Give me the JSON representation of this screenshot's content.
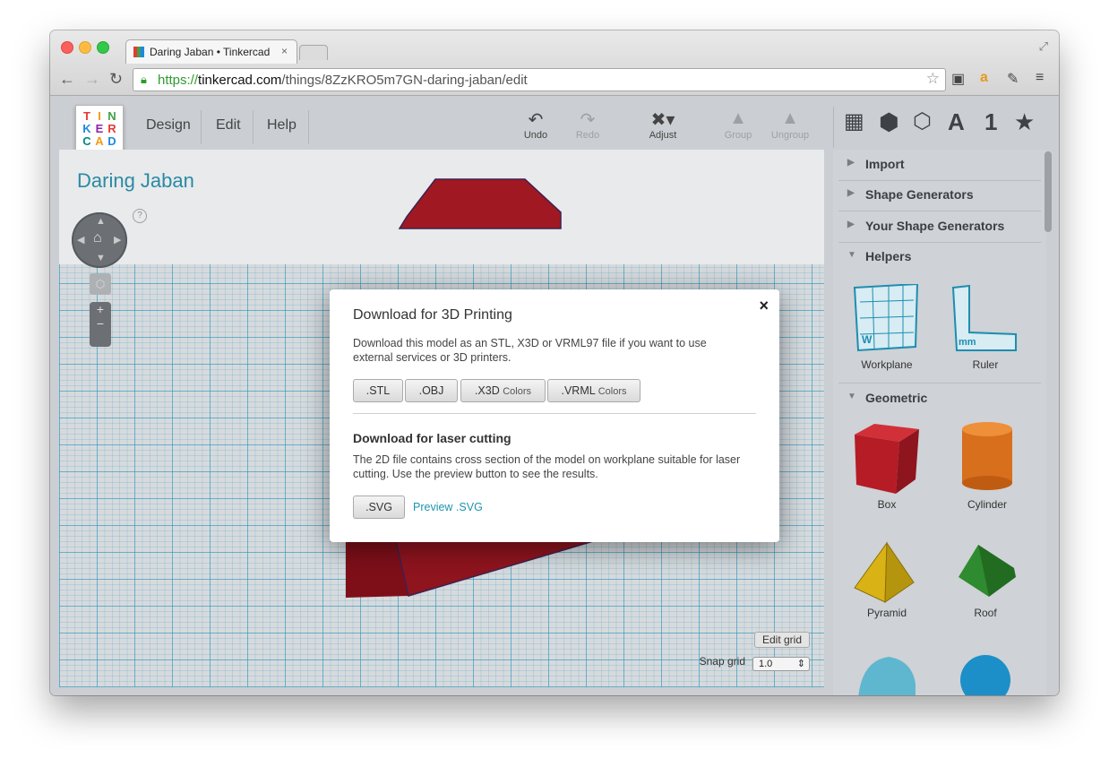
{
  "browser": {
    "tab_title": "Daring Jaban • Tinkercad",
    "tab_close": "×",
    "url_scheme": "https://",
    "url_host": "tinkercad.com",
    "url_path": "/things/8ZzKRO5m7GN-daring-jaban/edit"
  },
  "toolbar": {
    "logo_letters": [
      "T",
      "I",
      "N",
      "K",
      "E",
      "R",
      "C",
      "A",
      "D"
    ],
    "menus": [
      "Design",
      "Edit",
      "Help"
    ],
    "undo": "Undo",
    "redo": "Redo",
    "adjust": "Adjust",
    "group": "Group",
    "ungroup": "Ungroup",
    "right_icons": [
      "grid-icon",
      "box-view-icon",
      "cube-outline-icon",
      "text-icon",
      "number-icon",
      "star-icon"
    ],
    "text_tool": "A",
    "number_tool": "1"
  },
  "canvas": {
    "design_title": "Daring Jaban",
    "help": "?",
    "edit_grid": "Edit grid",
    "snap_label": "Snap grid",
    "snap_value": "1.0"
  },
  "sidebar": {
    "sections": [
      "Import",
      "Shape Generators",
      "Your Shape Generators",
      "Helpers",
      "Geometric"
    ],
    "helpers": [
      "Workplane",
      "Ruler"
    ],
    "geometric": [
      "Box",
      "Cylinder",
      "Pyramid",
      "Roof"
    ],
    "colors": {
      "box": "#b51c26",
      "cylinder": "#d86f1c",
      "pyramid": "#d9b316",
      "roof": "#2f8b2f",
      "halfcyl": "#5fb7cf",
      "sphere": "#1c8fc8"
    }
  },
  "modal": {
    "title": "Download for 3D Printing",
    "close": "×",
    "desc": "Download this model as an STL, X3D or VRML97 file if you want to use external services or 3D printers.",
    "buttons": [
      {
        "label": ".STL",
        "extra": ""
      },
      {
        "label": ".OBJ",
        "extra": ""
      },
      {
        "label": ".X3D",
        "extra": "Colors"
      },
      {
        "label": ".VRML",
        "extra": "Colors"
      }
    ],
    "laser_title": "Download for laser cutting",
    "laser_desc": "The 2D file contains cross section of the model on workplane suitable for laser cutting. Use the preview button to see the results.",
    "svg_button": ".SVG",
    "preview_link": "Preview .SVG"
  }
}
